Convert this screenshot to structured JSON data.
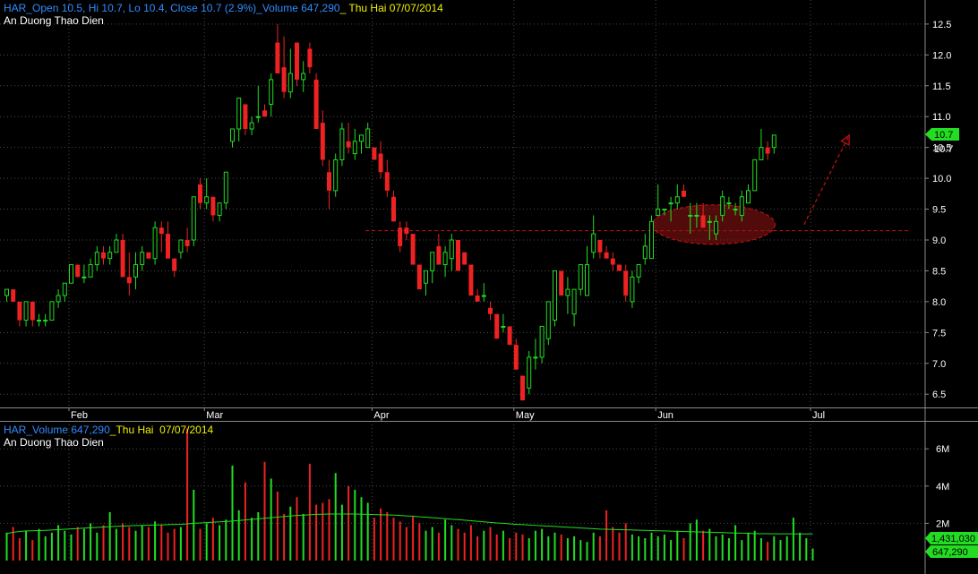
{
  "colors": {
    "background": "#000000",
    "grid": "#4a4a4a",
    "up": "#22dd22",
    "down": "#ee2222",
    "header_blue": "#2f8cff",
    "header_yellow": "#f2f200",
    "ma_line": "#22dd22",
    "annotation": "#cc1111"
  },
  "price_panel": {
    "header_ticker": "HAR_",
    "header_stats": "Open 10.5, Hi 10.7, Lo 10.4, Close 10.7 (2.9%)_Volume 647,290",
    "header_sep": "_",
    "header_date": "Thu Hai 07/07/2014",
    "company": "An Duong Thao Dien",
    "last_price_label": "10.7",
    "last_price_badge": "10.7"
  },
  "volume_panel": {
    "header_ticker": "HAR_",
    "header_stats": "Volume 647,290",
    "header_sep": "_",
    "header_date": "Thu Hai  07/07/2014",
    "company": "An Duong Thao Dien",
    "ma_badge": "1,431,030",
    "volume_badge": "647,290",
    "ma_value": 1431030
  },
  "chart_data": [
    {
      "type": "candlestick",
      "ylim": [
        6.3,
        12.6
      ],
      "y_ticks": [
        6.5,
        7.0,
        7.5,
        8.0,
        8.5,
        9.0,
        9.5,
        10.0,
        10.5,
        11.0,
        11.5,
        12.0,
        12.5
      ],
      "y_tick_labels": [
        "6.5",
        "7.0",
        "7.5",
        "8.0",
        "8.5",
        "9.0",
        "9.5",
        "10.0",
        "10.5",
        "11.0",
        "11.5",
        "12.0",
        "12.5"
      ],
      "month_labels": [
        {
          "label": "Feb",
          "index": 10
        },
        {
          "label": "Mar",
          "index": 31
        },
        {
          "label": "Apr",
          "index": 57
        },
        {
          "label": "May",
          "index": 79
        },
        {
          "label": "Jun",
          "index": 101
        },
        {
          "label": "Jul",
          "index": 125
        }
      ],
      "candles": [
        [
          8.1,
          8.2,
          8.0,
          8.2
        ],
        [
          8.2,
          8.2,
          8.0,
          8.0
        ],
        [
          8.0,
          8.0,
          7.6,
          7.7
        ],
        [
          7.7,
          8.0,
          7.6,
          8.0
        ],
        [
          8.0,
          8.0,
          7.6,
          7.7
        ],
        [
          7.7,
          7.8,
          7.6,
          7.7
        ],
        [
          7.7,
          7.8,
          7.6,
          7.7
        ],
        [
          7.7,
          8.0,
          7.7,
          8.0
        ],
        [
          8.0,
          8.2,
          7.9,
          8.1
        ],
        [
          8.1,
          8.3,
          8.0,
          8.3
        ],
        [
          8.3,
          8.6,
          8.3,
          8.6
        ],
        [
          8.6,
          8.6,
          8.4,
          8.4
        ],
        [
          8.4,
          8.6,
          8.3,
          8.4
        ],
        [
          8.4,
          8.7,
          8.4,
          8.6
        ],
        [
          8.6,
          8.9,
          8.5,
          8.8
        ],
        [
          8.8,
          8.9,
          8.6,
          8.7
        ],
        [
          8.7,
          8.9,
          8.6,
          8.8
        ],
        [
          8.8,
          9.1,
          8.8,
          9.0
        ],
        [
          9.0,
          9.1,
          8.4,
          8.4
        ],
        [
          8.4,
          8.8,
          8.1,
          8.3
        ],
        [
          8.4,
          8.8,
          8.2,
          8.6
        ],
        [
          8.6,
          8.9,
          8.5,
          8.8
        ],
        [
          8.8,
          8.8,
          8.7,
          8.7
        ],
        [
          8.7,
          9.3,
          8.6,
          9.2
        ],
        [
          9.2,
          9.3,
          8.8,
          9.1
        ],
        [
          9.1,
          9.3,
          8.7,
          8.7
        ],
        [
          8.7,
          8.7,
          8.4,
          8.5
        ],
        [
          8.8,
          9.0,
          8.7,
          9.0
        ],
        [
          9.0,
          9.2,
          8.8,
          8.9
        ],
        [
          9.0,
          9.7,
          8.9,
          9.7
        ],
        [
          9.9,
          10.0,
          9.5,
          9.6
        ],
        [
          9.6,
          10.0,
          9.5,
          9.7
        ],
        [
          9.7,
          9.7,
          9.3,
          9.4
        ],
        [
          9.4,
          9.6,
          9.3,
          9.6
        ],
        [
          9.6,
          10.1,
          9.5,
          10.1
        ],
        [
          10.6,
          10.8,
          10.5,
          10.8
        ],
        [
          10.8,
          11.3,
          10.6,
          11.3
        ],
        [
          11.2,
          11.2,
          10.7,
          10.8
        ],
        [
          10.8,
          11.0,
          10.7,
          10.9
        ],
        [
          11.0,
          11.5,
          10.9,
          11.0
        ],
        [
          11.1,
          11.2,
          11.0,
          11.0
        ],
        [
          11.2,
          11.7,
          11.0,
          11.6
        ],
        [
          12.2,
          12.5,
          11.7,
          11.7
        ],
        [
          11.8,
          12.3,
          11.3,
          11.4
        ],
        [
          11.4,
          12.1,
          11.3,
          11.7
        ],
        [
          12.2,
          12.2,
          11.5,
          11.6
        ],
        [
          11.6,
          11.9,
          11.4,
          11.7
        ],
        [
          12.1,
          12.2,
          11.7,
          11.8
        ],
        [
          11.6,
          11.7,
          10.8,
          10.8
        ],
        [
          10.9,
          11.1,
          10.2,
          10.3
        ],
        [
          10.1,
          10.3,
          9.5,
          9.8
        ],
        [
          9.8,
          10.4,
          9.7,
          10.3
        ],
        [
          10.3,
          10.9,
          10.2,
          10.8
        ],
        [
          10.6,
          10.9,
          10.4,
          10.5
        ],
        [
          10.4,
          10.8,
          10.3,
          10.6
        ],
        [
          10.6,
          10.7,
          10.4,
          10.7
        ],
        [
          10.5,
          10.9,
          10.5,
          10.8
        ],
        [
          10.5,
          10.5,
          10.3,
          10.3
        ],
        [
          10.4,
          10.6,
          10.0,
          10.1
        ],
        [
          10.1,
          10.3,
          9.7,
          9.8
        ],
        [
          9.7,
          9.8,
          9.3,
          9.3
        ],
        [
          9.2,
          9.3,
          8.8,
          8.9
        ],
        [
          9.2,
          9.3,
          9.0,
          9.1
        ],
        [
          9.1,
          9.1,
          8.6,
          8.6
        ],
        [
          8.6,
          8.6,
          8.2,
          8.2
        ],
        [
          8.3,
          8.5,
          8.1,
          8.5
        ],
        [
          8.5,
          8.8,
          8.3,
          8.8
        ],
        [
          8.9,
          9.1,
          8.6,
          8.6
        ],
        [
          8.6,
          8.9,
          8.4,
          8.8
        ],
        [
          8.7,
          9.1,
          8.5,
          9.0
        ],
        [
          9.0,
          9.0,
          8.5,
          8.5
        ],
        [
          8.8,
          8.8,
          8.6,
          8.6
        ],
        [
          8.6,
          8.6,
          8.1,
          8.1
        ],
        [
          8.1,
          8.2,
          8.0,
          8.0
        ],
        [
          8.1,
          8.3,
          8.0,
          8.1
        ],
        [
          7.9,
          8.0,
          7.7,
          7.8
        ],
        [
          7.8,
          7.8,
          7.4,
          7.4
        ],
        [
          7.6,
          7.8,
          7.5,
          7.6
        ],
        [
          7.6,
          7.6,
          7.3,
          7.3
        ],
        [
          7.3,
          7.4,
          6.9,
          6.9
        ],
        [
          6.8,
          6.8,
          6.4,
          6.4
        ],
        [
          6.6,
          7.2,
          6.5,
          7.1
        ],
        [
          7.1,
          7.4,
          6.9,
          7.1
        ],
        [
          7.1,
          7.6,
          7.0,
          7.6
        ],
        [
          7.4,
          8.0,
          7.3,
          8.0
        ],
        [
          7.7,
          8.5,
          7.6,
          8.5
        ],
        [
          8.5,
          8.5,
          8.1,
          8.1
        ],
        [
          8.1,
          8.4,
          7.8,
          8.2
        ],
        [
          7.8,
          8.2,
          7.6,
          8.2
        ],
        [
          8.2,
          8.6,
          8.1,
          8.6
        ],
        [
          8.1,
          8.9,
          8.1,
          8.6
        ],
        [
          8.8,
          9.4,
          8.7,
          9.1
        ],
        [
          9.0,
          9.0,
          8.7,
          8.8
        ],
        [
          8.8,
          8.9,
          8.7,
          8.7
        ],
        [
          8.7,
          8.8,
          8.5,
          8.6
        ],
        [
          8.6,
          8.6,
          8.5,
          8.5
        ],
        [
          8.5,
          8.6,
          8.0,
          8.1
        ],
        [
          8.0,
          8.5,
          7.9,
          8.4
        ],
        [
          8.4,
          8.6,
          8.3,
          8.6
        ],
        [
          8.7,
          9.1,
          8.6,
          8.9
        ],
        [
          8.7,
          9.4,
          8.7,
          9.3
        ],
        [
          9.4,
          9.9,
          9.4,
          9.5
        ],
        [
          9.5,
          9.5,
          9.4,
          9.5
        ],
        [
          9.6,
          9.7,
          9.3,
          9.6
        ],
        [
          9.6,
          9.9,
          9.5,
          9.7
        ],
        [
          9.8,
          9.9,
          9.7,
          9.7
        ],
        [
          9.4,
          9.6,
          9.1,
          9.4
        ],
        [
          9.4,
          9.6,
          9.2,
          9.4
        ],
        [
          9.4,
          9.6,
          9.2,
          9.2
        ],
        [
          9.3,
          9.4,
          9.0,
          9.3
        ],
        [
          9.1,
          9.4,
          9.0,
          9.3
        ],
        [
          9.4,
          9.8,
          9.3,
          9.7
        ],
        [
          9.6,
          9.7,
          9.5,
          9.6
        ],
        [
          9.5,
          9.6,
          9.4,
          9.5
        ],
        [
          9.4,
          9.8,
          9.3,
          9.7
        ],
        [
          9.6,
          9.9,
          9.6,
          9.8
        ],
        [
          9.8,
          10.3,
          9.8,
          10.3
        ],
        [
          10.3,
          10.8,
          10.3,
          10.5
        ],
        [
          10.5,
          10.6,
          10.3,
          10.4
        ],
        [
          10.5,
          10.7,
          10.4,
          10.7
        ]
      ],
      "annotations": {
        "support_level": 9.15,
        "support_from_index": 56,
        "ellipse_center_index": 110,
        "ellipse_center_value": 9.25,
        "ellipse_half_width_index": 9.5,
        "ellipse_half_height_value": 0.32,
        "arrow_from_index": 124,
        "arrow_from_value": 9.25,
        "arrow_to_index": 131,
        "arrow_to_value": 10.7
      }
    },
    {
      "type": "bar",
      "ylim": [
        0,
        7500000
      ],
      "y_ticks": [
        2000000,
        4000000,
        6000000
      ],
      "y_tick_labels": [
        "2M",
        "4M",
        "6M"
      ],
      "volumes": [
        1500000,
        1800000,
        1200000,
        1600000,
        1100000,
        1700000,
        1300000,
        1500000,
        1900000,
        1600000,
        1400000,
        1800000,
        1700000,
        2000000,
        1500000,
        1900000,
        2600000,
        1700000,
        2000000,
        1800000,
        1600000,
        1900000,
        1800000,
        2100000,
        1900000,
        1500000,
        1700000,
        1800000,
        7100000,
        3800000,
        1700000,
        2000000,
        2300000,
        1900000,
        2200000,
        5100000,
        2700000,
        4200000,
        2300000,
        2600000,
        5300000,
        4400000,
        3700000,
        2500000,
        2900000,
        3400000,
        2500000,
        5200000,
        3000000,
        3100000,
        3300000,
        4700000,
        3000000,
        4000000,
        3800000,
        3400000,
        3100000,
        2300000,
        2800000,
        2600000,
        2300000,
        2100000,
        1800000,
        2400000,
        2000000,
        1600000,
        1800000,
        1500000,
        2200000,
        1900000,
        1700000,
        1500000,
        1900000,
        1300000,
        1600000,
        1800000,
        1400000,
        1600000,
        1200000,
        1500000,
        1400000,
        1200000,
        1600000,
        1700000,
        1300000,
        1500000,
        1400000,
        1200000,
        1300000,
        1100000,
        1000000,
        1500000,
        1300000,
        2700000,
        1800000,
        1500000,
        2000000,
        1400000,
        1300000,
        1200000,
        1500000,
        1300000,
        1400000,
        1100000,
        1600000,
        1200000,
        2000000,
        2200000,
        1600000,
        1700000,
        1300000,
        1400000,
        1200000,
        1900000,
        1100000,
        1500000,
        1600000,
        1200000,
        1000000,
        1300000,
        1100000,
        1300000,
        2300000,
        1500000,
        1200000,
        647290
      ],
      "ma": [
        1450000,
        1520000,
        1560000,
        1590000,
        1600000,
        1610000,
        1620000,
        1640000,
        1660000,
        1680000,
        1700000,
        1720000,
        1740000,
        1760000,
        1780000,
        1800000,
        1820000,
        1840000,
        1850000,
        1870000,
        1880000,
        1890000,
        1900000,
        1910000,
        1920000,
        1930000,
        1940000,
        1950000,
        1970000,
        2000000,
        2020000,
        2040000,
        2060000,
        2080000,
        2100000,
        2120000,
        2150000,
        2180000,
        2210000,
        2240000,
        2270000,
        2300000,
        2330000,
        2360000,
        2390000,
        2420000,
        2440000,
        2460000,
        2480000,
        2490000,
        2500000,
        2500000,
        2500000,
        2500000,
        2500000,
        2490000,
        2480000,
        2470000,
        2460000,
        2450000,
        2440000,
        2420000,
        2400000,
        2380000,
        2350000,
        2330000,
        2300000,
        2280000,
        2250000,
        2220000,
        2200000,
        2170000,
        2140000,
        2110000,
        2080000,
        2050000,
        2020000,
        2000000,
        1970000,
        1950000,
        1930000,
        1910000,
        1890000,
        1870000,
        1850000,
        1830000,
        1810000,
        1790000,
        1770000,
        1750000,
        1730000,
        1710000,
        1690000,
        1680000,
        1670000,
        1660000,
        1650000,
        1640000,
        1630000,
        1620000,
        1610000,
        1600000,
        1590000,
        1580000,
        1570000,
        1560000,
        1550000,
        1540000,
        1530000,
        1520000,
        1510000,
        1500000,
        1490000,
        1480000,
        1470000,
        1460000,
        1450000,
        1445000,
        1440000,
        1438000,
        1436000,
        1434000,
        1433000,
        1432000,
        1431500,
        1431030
      ]
    }
  ]
}
